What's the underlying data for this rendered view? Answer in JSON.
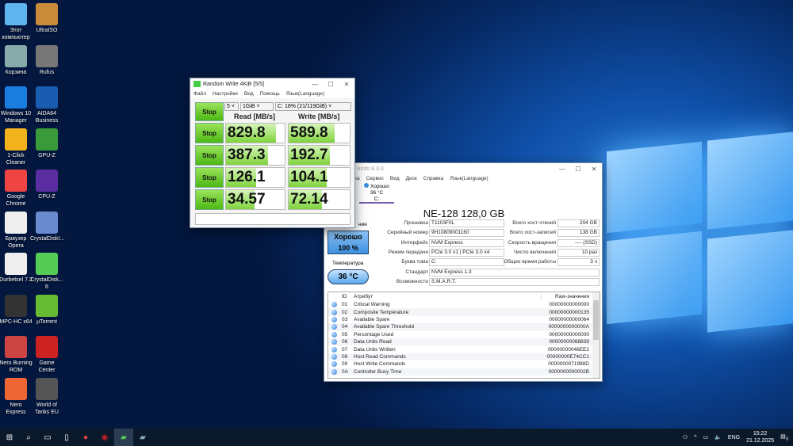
{
  "desktop": {
    "icons": [
      {
        "label": "Этот компьютер",
        "color": "#5fb6ee"
      },
      {
        "label": "UltraISO",
        "color": "#c98a3a"
      },
      {
        "label": "Корзина",
        "color": "#8aa"
      },
      {
        "label": "Rufus",
        "color": "#777"
      },
      {
        "label": "Windows 10 Manager",
        "color": "#1a7ee0"
      },
      {
        "label": "AIDA64 Business",
        "color": "#1a5db0"
      },
      {
        "label": "1-Click Cleaner",
        "color": "#f2b21c"
      },
      {
        "label": "GPU-Z",
        "color": "#3a9a3a"
      },
      {
        "label": "Google Chrome",
        "color": "#e44"
      },
      {
        "label": "CPU-Z",
        "color": "#5a2ea0"
      },
      {
        "label": "Браузер Opera",
        "color": "#eee"
      },
      {
        "label": "CrystalDiskI...",
        "color": "#6a8ad0"
      },
      {
        "label": "Durbetsel 7.2",
        "color": "#eee"
      },
      {
        "label": "CrystalDisk... 6",
        "color": "#5c5"
      },
      {
        "label": "MPC-HC x64",
        "color": "#333"
      },
      {
        "label": "µTorrent",
        "color": "#6b3"
      },
      {
        "label": "Nero Burning ROM",
        "color": "#c44"
      },
      {
        "label": "Game Center",
        "color": "#c22"
      },
      {
        "label": "Nero Express",
        "color": "#e63"
      },
      {
        "label": "World of Tanks EU",
        "color": "#555"
      }
    ]
  },
  "cdm": {
    "title": "Random Write 4KiB [5/5]",
    "menu": [
      "Файл",
      "Настройки",
      "Вид",
      "Помощь",
      "Язык(Language)"
    ],
    "count": "5",
    "size": "1GiB",
    "drive": "C: 18% (21/119GiB)",
    "read_header": "Read [MB/s]",
    "write_header": "Write [MB/s]",
    "stop_label": "Stop",
    "rows": [
      {
        "read": "829.8",
        "write": "589.8",
        "read_fill": 0.85,
        "write_fill": 0.75
      },
      {
        "read": "387.3",
        "write": "192.7",
        "read_fill": 0.72,
        "write_fill": 0.68
      },
      {
        "read": "126.1",
        "write": "104.1",
        "read_fill": 0.52,
        "write_fill": 0.62
      },
      {
        "read": "34.57",
        "write": "72.14",
        "read_fill": 0.48,
        "write_fill": 0.55
      }
    ],
    "status": ""
  },
  "cdi": {
    "title": "kInfo 8.3.0",
    "menu": [
      "ка",
      "Сервис",
      "Вид",
      "Диск",
      "Справка",
      "Язык(Language)"
    ],
    "disk_tab": {
      "status": "Хорошо",
      "temp": "36 °C",
      "letter": "C:"
    },
    "model": "NE-128 128,0 GB",
    "health_label": "ние",
    "health_status": "Хорошо",
    "health_pct": "100 %",
    "temp_label": "Температура",
    "temp": "36 °C",
    "left_fields": [
      {
        "label": "Прошивка",
        "value": "T1103F0L"
      },
      {
        "label": "Серийный номер",
        "value": "9H10809001160"
      },
      {
        "label": "Интерфейс",
        "value": "NVM Express"
      },
      {
        "label": "Режим передачи",
        "value": "PCIe 3.0 x1 | PCIe 3.0 x4"
      },
      {
        "label": "Буква тома",
        "value": "C:"
      }
    ],
    "right_fields": [
      {
        "label": "Всего хост-чтений",
        "value": "204 GB"
      },
      {
        "label": "Всего хост-записей",
        "value": "138 GB"
      },
      {
        "label": "Скорость вращения",
        "value": "---- (SSD)"
      },
      {
        "label": "Число включений",
        "value": "10 раз"
      },
      {
        "label": "Общее время работы",
        "value": "3 ч"
      }
    ],
    "wide_fields": [
      {
        "label": "Стандарт",
        "value": "NVM Express 1.3"
      },
      {
        "label": "Возможности",
        "value": "S.M.A.R.T."
      }
    ],
    "table_headers": {
      "id": "ID",
      "attr": "Атрибут",
      "raw": "Raw-значения"
    },
    "attributes": [
      [
        "01",
        "Critical Warning",
        "00000000000000"
      ],
      [
        "02",
        "Composite Temperature",
        "00000000000135"
      ],
      [
        "03",
        "Available Spare",
        "00000000000064"
      ],
      [
        "04",
        "Available Spare Threshold",
        "0000000000000A"
      ],
      [
        "05",
        "Percentage Used",
        "00000000000000"
      ],
      [
        "06",
        "Data Units Read",
        "00000000068839"
      ],
      [
        "07",
        "Data Units Written",
        "00000000046EE2"
      ],
      [
        "08",
        "Host Read Commands",
        "00000000E74CC1"
      ],
      [
        "09",
        "Host Write Commands",
        "0000000071998D"
      ],
      [
        "0A",
        "Controller Busy Time",
        "0000000000002B"
      ]
    ]
  },
  "taskbar": {
    "lang": "ENG",
    "time": "15:22",
    "date": "21.12.2025",
    "notifications": "3"
  }
}
